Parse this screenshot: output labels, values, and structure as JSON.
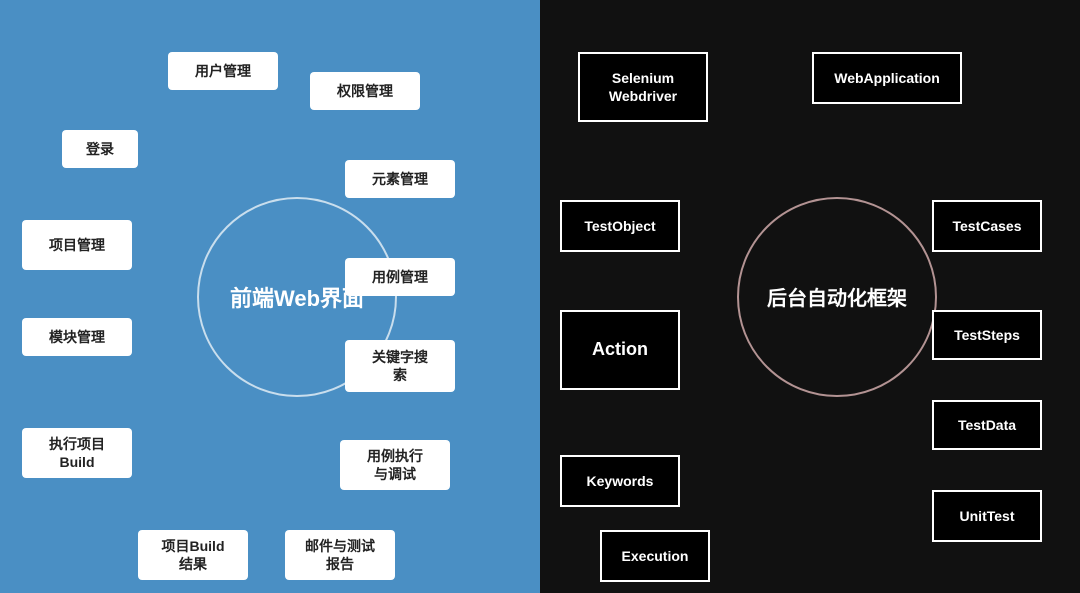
{
  "left": {
    "bg_color": "#4a8fc4",
    "circle_label": "前端Web界面",
    "nodes": [
      {
        "id": "user-mgmt",
        "label": "用户管理"
      },
      {
        "id": "auth-mgmt",
        "label": "权限管理"
      },
      {
        "id": "login",
        "label": "登录"
      },
      {
        "id": "elem-mgmt",
        "label": "元素管理"
      },
      {
        "id": "proj-mgmt",
        "label": "项目管理"
      },
      {
        "id": "case-mgmt",
        "label": "用例管理"
      },
      {
        "id": "module-mgmt",
        "label": "模块管理"
      },
      {
        "id": "keyword-search",
        "label": "关键字搜索"
      },
      {
        "id": "exec-proj",
        "label": "执行项目\nBuild"
      },
      {
        "id": "case-exec",
        "label": "用例执行\n与调试"
      },
      {
        "id": "proj-build-result",
        "label": "项目Build\n结果"
      },
      {
        "id": "mail-test",
        "label": "邮件与测试\n报告"
      }
    ]
  },
  "right": {
    "bg_color": "#111111",
    "circle_label": "后台自动化框架",
    "nodes": [
      {
        "id": "selenium",
        "label": "Selenium\nWebdriver"
      },
      {
        "id": "webapp",
        "label": "WebApplication"
      },
      {
        "id": "testobj",
        "label": "TestObject"
      },
      {
        "id": "testcases",
        "label": "TestCases"
      },
      {
        "id": "action",
        "label": "Action"
      },
      {
        "id": "teststeps",
        "label": "TestSteps"
      },
      {
        "id": "testdata",
        "label": "TestData"
      },
      {
        "id": "keywords",
        "label": "Keywords"
      },
      {
        "id": "execution",
        "label": "Execution"
      },
      {
        "id": "unittest",
        "label": "UnitTest"
      }
    ]
  }
}
